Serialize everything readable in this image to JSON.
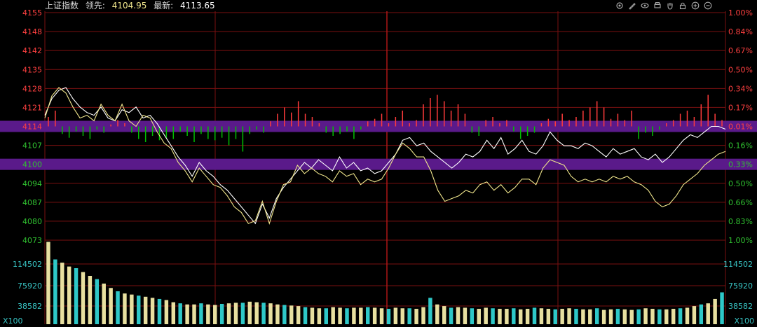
{
  "header": {
    "index_name": "上证指数",
    "leading_label": "领先:",
    "leading_value": "4104.95",
    "latest_label": "最新:",
    "latest_value": "4113.65"
  },
  "toolbar": [
    {
      "name": "settings-icon"
    },
    {
      "name": "draw-pen-icon"
    },
    {
      "name": "eye-icon"
    },
    {
      "name": "print-icon"
    },
    {
      "name": "hand-icon"
    },
    {
      "name": "lock-icon"
    },
    {
      "name": "zoom-in-icon"
    },
    {
      "name": "zoom-out-icon"
    }
  ],
  "colors": {
    "background": "#000000",
    "grid": "#7a1010",
    "price_line": "#ffffff",
    "lead_line": "#f0e68c",
    "up_bar": "#ff3b3b",
    "down_bar": "#00c000",
    "volume_bar": "#e8e0a0",
    "volume_bar_alt": "#2ec8c8",
    "highlight": "#5a1a8a",
    "left_tick_up": "#ff4040",
    "left_tick_down": "#30c030",
    "right_tick_up": "#ff4040",
    "right_tick_down": "#30c030"
  },
  "chart_data": {
    "type": "line",
    "title": "上证指数",
    "price_axis": {
      "ticks_left": [
        "4155",
        "4148",
        "4142",
        "4135",
        "4128",
        "4121",
        "4114",
        "4107",
        "4100",
        "4094",
        "4087",
        "4080",
        "4073"
      ],
      "ticks_right": [
        "1.00%",
        "0.84%",
        "0.67%",
        "0.50%",
        "0.34%",
        "0.17%",
        "0.01%",
        "0.16%",
        "0.33%",
        "0.50%",
        "0.66%",
        "0.83%",
        "1.00%"
      ],
      "ylim": [
        4073,
        4155
      ],
      "highlighted": [
        "4114",
        "4100"
      ],
      "highlighted_right": [
        "0.01%",
        "0.33%"
      ]
    },
    "volume_axis": {
      "ticks": [
        "114502",
        "75920",
        "38582"
      ],
      "unit": "X100",
      "ylim": [
        0,
        153000
      ]
    },
    "series": [
      {
        "key": "price",
        "values": [
          4118,
          4124,
          4127,
          4128,
          4124,
          4121,
          4119,
          4118,
          4121,
          4117,
          4116,
          4120,
          4119,
          4121,
          4117,
          4118,
          4115,
          4111,
          4107,
          4103,
          4100,
          4096,
          4101,
          4098,
          4096,
          4093,
          4091,
          4088,
          4085,
          4082,
          4079,
          4086,
          4081,
          4088,
          4092,
          4095,
          4098,
          4101,
          4099,
          4102,
          4100,
          4098,
          4103,
          4099,
          4101,
          4098,
          4099,
          4097,
          4098,
          4101,
          4104,
          4109,
          4110,
          4107,
          4108,
          4105,
          4103,
          4101,
          4099,
          4101,
          4104,
          4103,
          4105,
          4109,
          4106,
          4110,
          4104,
          4106,
          4109,
          4105,
          4104,
          4107,
          4112,
          4109,
          4107,
          4107,
          4106,
          4108,
          4107,
          4105,
          4103,
          4106,
          4104,
          4105,
          4106,
          4103,
          4102,
          4104,
          4101,
          4103,
          4106,
          4109,
          4111,
          4110,
          4112,
          4114,
          4114,
          4113
        ]
      },
      {
        "key": "lead",
        "values": [
          4117,
          4125,
          4128,
          4126,
          4121,
          4117,
          4118,
          4116,
          4122,
          4118,
          4116,
          4122,
          4116,
          4114,
          4118,
          4117,
          4112,
          4108,
          4106,
          4101,
          4098,
          4094,
          4099,
          4096,
          4093,
          4092,
          4089,
          4085,
          4083,
          4079,
          4080,
          4087,
          4079,
          4087,
          4093,
          4094,
          4100,
          4097,
          4099,
          4097,
          4096,
          4094,
          4098,
          4096,
          4097,
          4093,
          4095,
          4094,
          4095,
          4099,
          4104,
          4108,
          4106,
          4103,
          4103,
          4098,
          4091,
          4087,
          4088,
          4089,
          4091,
          4090,
          4093,
          4094,
          4091,
          4093,
          4090,
          4092,
          4095,
          4095,
          4093,
          4099,
          4102,
          4101,
          4100,
          4096,
          4094,
          4095,
          4094,
          4095,
          4094,
          4096,
          4095,
          4096,
          4094,
          4093,
          4091,
          4087,
          4085,
          4086,
          4089,
          4093,
          4095,
          4097,
          4100,
          4102,
          4104,
          4105
        ]
      }
    ],
    "diff_bars": [
      1.5,
      2.5,
      -1.2,
      -1.8,
      -0.8,
      -1.5,
      -2,
      -0.5,
      -1,
      0.3,
      1,
      0.5,
      -1,
      -2,
      -2.5,
      -1.5,
      -2.2,
      -1.8,
      -2,
      -0.8,
      -1.5,
      -2.5,
      -1.2,
      -2,
      -2.2,
      -1.8,
      -3,
      -2,
      -4,
      -1.2,
      -0.5,
      -1,
      0.8,
      2,
      3,
      2.2,
      4,
      2,
      1.5,
      0.5,
      -1,
      -1.5,
      -1.2,
      -0.8,
      -2,
      -0.5,
      0.8,
      1.2,
      2,
      0.5,
      1.5,
      2.5,
      0.5,
      1,
      3.5,
      4.5,
      5,
      4,
      2.5,
      3.5,
      2,
      -1,
      -1.5,
      1,
      1.5,
      0.5,
      1,
      -0.8,
      -2,
      -1.5,
      -1,
      0.5,
      1.2,
      0.8,
      2,
      1,
      1.5,
      2.5,
      3,
      4,
      3,
      1.2,
      2,
      1,
      2.5,
      -2,
      -1,
      -1.5,
      -0.5,
      0.5,
      1,
      2,
      2.5,
      1.5,
      3.5,
      5,
      2,
      1
    ],
    "volume": [
      150000,
      118000,
      112000,
      105000,
      102000,
      95000,
      88000,
      82000,
      74000,
      66000,
      60000,
      56000,
      54000,
      52000,
      50000,
      48000,
      46000,
      44000,
      40000,
      38000,
      36000,
      36000,
      38000,
      36000,
      35000,
      37000,
      38000,
      39000,
      39000,
      41000,
      40000,
      39000,
      38000,
      36000,
      35000,
      34000,
      33000,
      31000,
      30000,
      29000,
      29000,
      31000,
      30000,
      29000,
      30000,
      30000,
      31000,
      30000,
      29000,
      28000,
      30000,
      29000,
      29000,
      28000,
      31000,
      48000,
      36000,
      33000,
      30000,
      31000,
      30000,
      29000,
      28000,
      30000,
      29000,
      28000,
      28000,
      29000,
      27000,
      28000,
      30000,
      29000,
      28000,
      27000,
      28000,
      29000,
      28000,
      27000,
      27000,
      29000,
      26000,
      27000,
      28000,
      27000,
      26000,
      27000,
      29000,
      28000,
      27000,
      27000,
      28000,
      29000,
      30000,
      33000,
      36000,
      38000,
      46000,
      58000
    ]
  }
}
